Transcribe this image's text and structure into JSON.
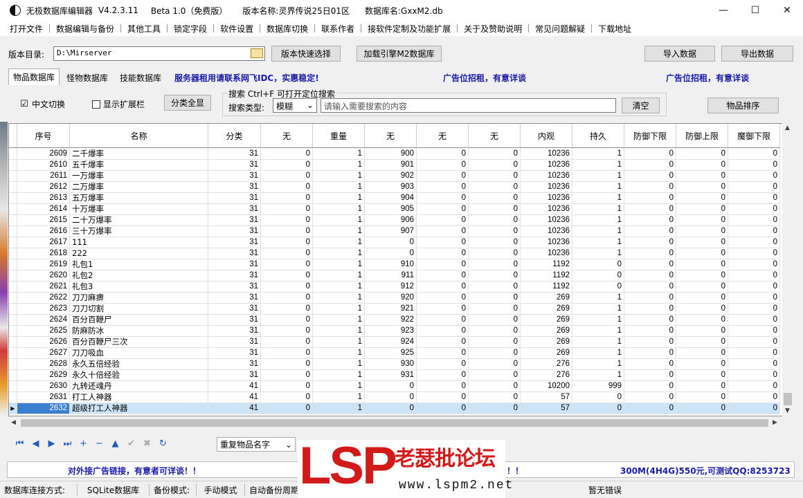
{
  "titlebar": {
    "app": "无极数据库编辑器",
    "version": "V4.2.3.11",
    "beta": "Beta 1.0（免费版）",
    "edition_label": "版本名称:灵界传说25日01区",
    "db_label": "数据库名:GxxM2.db",
    "minimize": "—",
    "maximize": "☐",
    "close": "✕"
  },
  "menu": [
    "打开文件",
    "数据编辑与备份",
    "其他工具",
    "锁定字段",
    "软件设置",
    "数据库切换",
    "联系作者",
    "接软件定制及功能扩展",
    "关于及赞助说明",
    "常见问题解疑",
    "下载地址"
  ],
  "toolbar": {
    "dir_label": "版本目录:",
    "dir_value": "D:\\Mirserver",
    "quick_select": "版本快速选择",
    "load_engine": "加载引擎M2数据库",
    "import": "导入数据",
    "export": "导出数据"
  },
  "tabs": [
    "物品数据库",
    "怪物数据库",
    "技能数据库"
  ],
  "ads": {
    "ad1": "服务器租用请联系网飞IDC，实惠稳定!",
    "ad2": "广告位招租，有意详谈",
    "ad3": "广告位招租，有意详谈",
    "bottom_left": "对外接广告链接，有意者可详谈！！",
    "bottom_mid": "！！",
    "bottom_right": "300M(4H4G)550元,可测试QQ:8253723"
  },
  "options": {
    "chinese_switch": "中文切换",
    "chinese_checked": "☑",
    "show_ext": "显示扩展栏",
    "category_all": "分类全显",
    "sort_items": "物品排序"
  },
  "search": {
    "title": "搜索 Ctrl+F 可打开定位搜索",
    "type_label": "搜索类型:",
    "type_value": "模糊",
    "placeholder": "请输入需要搜索的内容",
    "clear": "清空"
  },
  "grid": {
    "columns": [
      "序号",
      "名称",
      "分类",
      "无",
      "重量",
      "无",
      "无",
      "无",
      "内观",
      "持久",
      "防御下限",
      "防御上限",
      "魔御下限"
    ],
    "rows": [
      [
        "2609",
        "二千爆率",
        "31",
        "0",
        "1",
        "900",
        "0",
        "0",
        "10236",
        "1",
        "0",
        "0",
        "0"
      ],
      [
        "2610",
        "五千爆率",
        "31",
        "0",
        "1",
        "901",
        "0",
        "0",
        "10236",
        "1",
        "0",
        "0",
        "0"
      ],
      [
        "2611",
        "一万爆率",
        "31",
        "0",
        "1",
        "902",
        "0",
        "0",
        "10236",
        "1",
        "0",
        "0",
        "0"
      ],
      [
        "2612",
        "二万爆率",
        "31",
        "0",
        "1",
        "903",
        "0",
        "0",
        "10236",
        "1",
        "0",
        "0",
        "0"
      ],
      [
        "2613",
        "五万爆率",
        "31",
        "0",
        "1",
        "904",
        "0",
        "0",
        "10236",
        "1",
        "0",
        "0",
        "0"
      ],
      [
        "2614",
        "十万爆率",
        "31",
        "0",
        "1",
        "905",
        "0",
        "0",
        "10236",
        "1",
        "0",
        "0",
        "0"
      ],
      [
        "2615",
        "二十万爆率",
        "31",
        "0",
        "1",
        "906",
        "0",
        "0",
        "10236",
        "1",
        "0",
        "0",
        "0"
      ],
      [
        "2616",
        "三十万爆率",
        "31",
        "0",
        "1",
        "907",
        "0",
        "0",
        "10236",
        "1",
        "0",
        "0",
        "0"
      ],
      [
        "2617",
        "111",
        "31",
        "0",
        "1",
        "0",
        "0",
        "0",
        "10236",
        "1",
        "0",
        "0",
        "0"
      ],
      [
        "2618",
        "222",
        "31",
        "0",
        "1",
        "0",
        "0",
        "0",
        "10236",
        "1",
        "0",
        "0",
        "0"
      ],
      [
        "2619",
        "礼包1",
        "31",
        "0",
        "1",
        "910",
        "0",
        "0",
        "1192",
        "0",
        "0",
        "0",
        "0"
      ],
      [
        "2620",
        "礼包2",
        "31",
        "0",
        "1",
        "911",
        "0",
        "0",
        "1192",
        "0",
        "0",
        "0",
        "0"
      ],
      [
        "2621",
        "礼包3",
        "31",
        "0",
        "1",
        "912",
        "0",
        "0",
        "1192",
        "0",
        "0",
        "0",
        "0"
      ],
      [
        "2622",
        "刀刀麻痹",
        "31",
        "0",
        "1",
        "920",
        "0",
        "0",
        "269",
        "1",
        "0",
        "0",
        "0"
      ],
      [
        "2623",
        "刀刀切割",
        "31",
        "0",
        "1",
        "921",
        "0",
        "0",
        "269",
        "1",
        "0",
        "0",
        "0"
      ],
      [
        "2624",
        "百分百鞭尸",
        "31",
        "0",
        "1",
        "922",
        "0",
        "0",
        "269",
        "1",
        "0",
        "0",
        "0"
      ],
      [
        "2625",
        "防麻防冰",
        "31",
        "0",
        "1",
        "923",
        "0",
        "0",
        "269",
        "1",
        "0",
        "0",
        "0"
      ],
      [
        "2626",
        "百分百鞭尸三次",
        "31",
        "0",
        "1",
        "924",
        "0",
        "0",
        "269",
        "1",
        "0",
        "0",
        "0"
      ],
      [
        "2627",
        "刀刀吸血",
        "31",
        "0",
        "1",
        "925",
        "0",
        "0",
        "269",
        "1",
        "0",
        "0",
        "0"
      ],
      [
        "2628",
        "永久五倍经验",
        "31",
        "0",
        "1",
        "930",
        "0",
        "0",
        "276",
        "1",
        "0",
        "0",
        "0"
      ],
      [
        "2629",
        "永久十倍经验",
        "31",
        "0",
        "1",
        "931",
        "0",
        "0",
        "276",
        "1",
        "0",
        "0",
        "0"
      ],
      [
        "2630",
        "九转还魂丹",
        "41",
        "0",
        "1",
        "0",
        "0",
        "0",
        "10200",
        "999",
        "0",
        "0",
        "0"
      ],
      [
        "2631",
        "打工人神器",
        "41",
        "0",
        "1",
        "0",
        "0",
        "0",
        "57",
        "0",
        "0",
        "0",
        "0"
      ],
      [
        "2632",
        "超级打工人神器",
        "41",
        "0",
        "1",
        "0",
        "0",
        "0",
        "57",
        "0",
        "0",
        "0",
        "0"
      ]
    ],
    "selected_index": 23,
    "row_pointer": "▶"
  },
  "nav": {
    "icons": [
      "first-icon",
      "prev-icon",
      "next-icon",
      "last-icon",
      "add-icon",
      "delete-icon",
      "up-icon",
      "confirm-icon",
      "cancel-icon",
      "refresh-icon"
    ],
    "glyphs": [
      "⏮",
      "◀",
      "▶",
      "⏭",
      "+",
      "−",
      "▲",
      "✔",
      "✖",
      "↻"
    ],
    "dup_select": "重复物品名字",
    "dup_arrow": "⌄"
  },
  "status": {
    "conn_label": "数据库连接方式:",
    "conn_value": "SQLite数据库",
    "backup_label": "备份模式:",
    "backup_value": "手动模式",
    "auto_label": "自动备份周期:",
    "error": "暂无错误"
  },
  "watermark": {
    "brand": "LSP",
    "cn": "老瑟批论坛",
    "url": "www.lspm2.net"
  },
  "colors": {
    "ad_text": "#1a1aa8",
    "selected_row": "#cce4f7",
    "watermark_red": "#d31a1a"
  }
}
